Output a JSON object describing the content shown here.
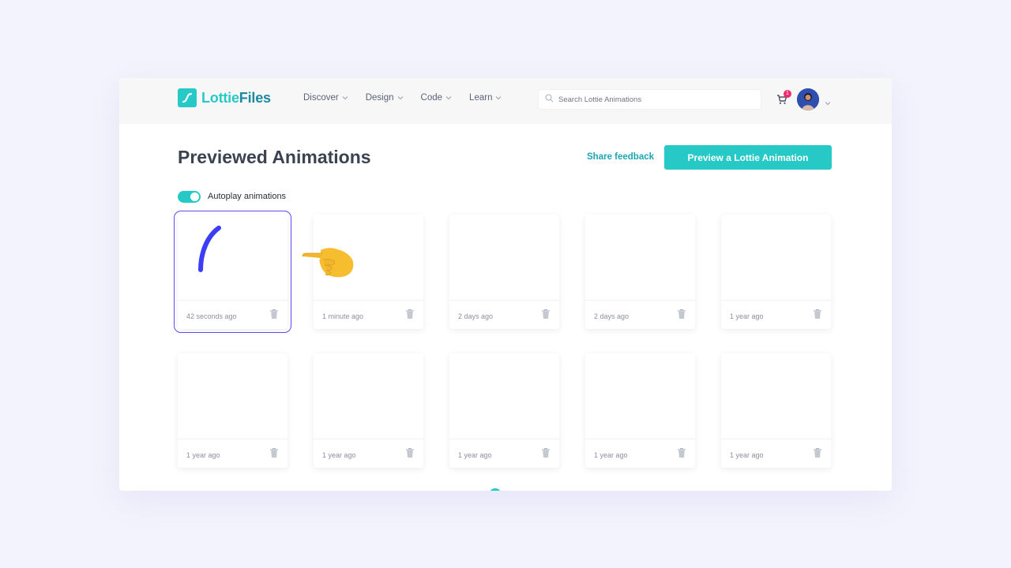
{
  "brand": {
    "name_part1": "Lottie",
    "name_part2": "Files",
    "primary_color": "#27c9c7",
    "secondary_color": "#1d8aa0"
  },
  "nav": {
    "items": [
      {
        "label": "Discover"
      },
      {
        "label": "Design"
      },
      {
        "label": "Code"
      },
      {
        "label": "Learn"
      }
    ]
  },
  "search": {
    "placeholder": "Search Lottie Animations",
    "value": ""
  },
  "cart": {
    "badge_count": "1",
    "badge_color": "#ef2a6a"
  },
  "page": {
    "title": "Previewed Animations",
    "share_feedback": "Share feedback",
    "preview_button": "Preview a Lottie Animation",
    "autoplay_label": "Autoplay animations",
    "autoplay_on": true
  },
  "cards": [
    {
      "time": "42 seconds ago",
      "preview": "blue-arc"
    },
    {
      "time": "1 minute ago",
      "preview": "empty"
    },
    {
      "time": "2 days ago",
      "preview": "empty"
    },
    {
      "time": "2 days ago",
      "preview": "empty"
    },
    {
      "time": "1 year ago",
      "preview": "empty"
    },
    {
      "time": "1 year ago",
      "preview": "empty"
    },
    {
      "time": "1 year ago",
      "preview": "empty"
    },
    {
      "time": "1 year ago",
      "preview": "empty"
    },
    {
      "time": "1 year ago",
      "preview": "empty"
    },
    {
      "time": "1 year ago",
      "preview": "empty"
    }
  ],
  "annotation": {
    "pointer": "pointing-hand-emoji"
  }
}
